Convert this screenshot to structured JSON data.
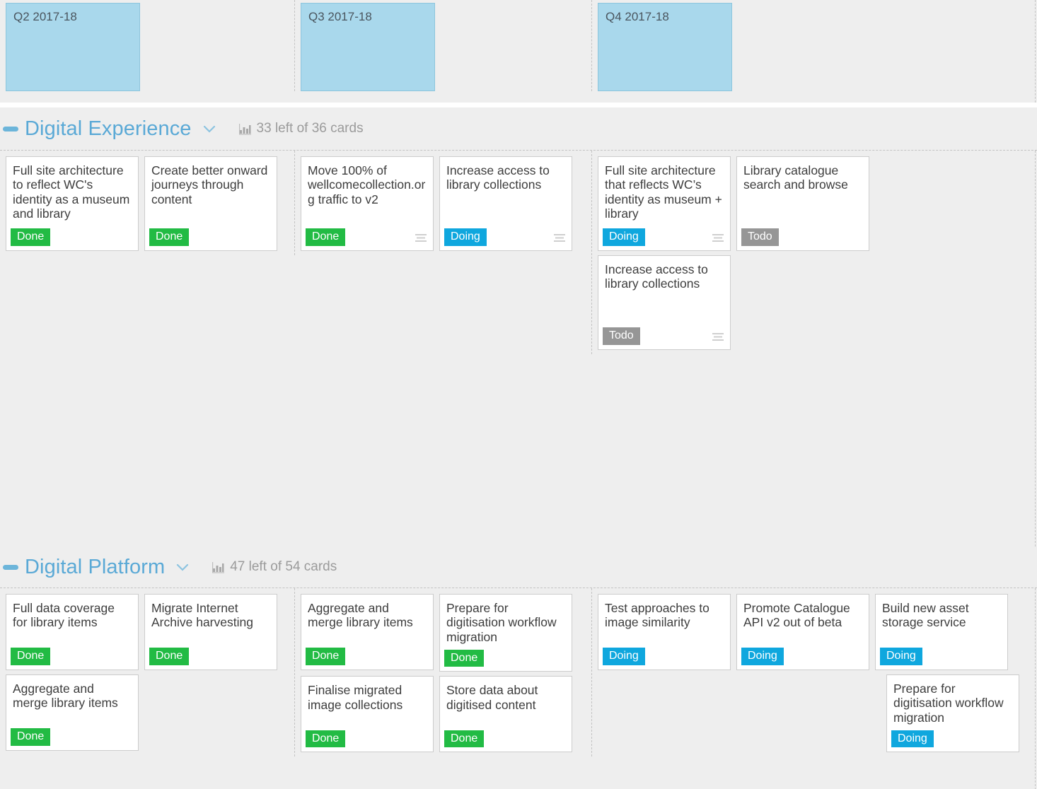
{
  "board": {
    "background_color": "#eeeeee",
    "card_background": "#ffffff",
    "accent_color": "#5aa9d6",
    "quarter_card_color": "#a9d8ec",
    "status_colors": {
      "Done": "#22bb44",
      "Doing": "#0fa7de",
      "Todo": "#969696"
    }
  },
  "timeline": {
    "quarters": [
      {
        "label": "Q2 2017-18"
      },
      {
        "label": "Q3 2017-18"
      },
      {
        "label": "Q4 2017-18"
      }
    ]
  },
  "swimlanes": [
    {
      "id": "digital-experience",
      "title": "Digital Experience",
      "count_text": "33 left of 36 cards",
      "collapse_icon": "minus-icon",
      "chevron_icon": "chevron-down-icon",
      "chart_icon": "bar-chart-icon",
      "columns": [
        {
          "quarter": "Q2 2017-18",
          "cards": [
            {
              "title": "Full site architecture to reflect WC's identity as a museum and library",
              "status": "Done",
              "has_description": false
            },
            {
              "title": "Create better onward journeys through content",
              "status": "Done",
              "has_description": false
            }
          ]
        },
        {
          "quarter": "Q3 2017-18",
          "cards": [
            {
              "title": "Move 100% of wellcomecollection.org traffic to v2",
              "status": "Done",
              "has_description": true
            },
            {
              "title": "Increase access to library collections",
              "status": "Doing",
              "has_description": true
            }
          ]
        },
        {
          "quarter": "Q4 2017-18",
          "cards": [
            {
              "title": "Full site architecture that reflects WC’s identity as museum + library",
              "status": "Doing",
              "has_description": true
            },
            {
              "title": "Library catalogue search and browse",
              "status": "Todo",
              "has_description": false
            },
            {
              "title": "Increase access to library collections",
              "status": "Todo",
              "has_description": true
            }
          ]
        }
      ]
    },
    {
      "id": "digital-platform",
      "title": "Digital Platform",
      "count_text": "47 left of 54 cards",
      "collapse_icon": "minus-icon",
      "chevron_icon": "chevron-down-icon",
      "chart_icon": "bar-chart-icon",
      "columns": [
        {
          "quarter": "Q2 2017-18",
          "cards": [
            {
              "title": "Full data coverage for library items",
              "status": "Done",
              "has_description": false
            },
            {
              "title": "Migrate Internet Archive harvesting",
              "status": "Done",
              "has_description": false
            },
            {
              "title": "Aggregate and merge library items",
              "status": "Done",
              "has_description": false
            }
          ]
        },
        {
          "quarter": "Q3 2017-18",
          "cards": [
            {
              "title": "Aggregate and merge library items",
              "status": "Done",
              "has_description": false
            },
            {
              "title": "Prepare for digitisation workflow migration",
              "status": "Done",
              "has_description": false
            },
            {
              "title": "Finalise migrated image collections",
              "status": "Done",
              "has_description": false
            },
            {
              "title": "Store data about digitised content",
              "status": "Done",
              "has_description": false
            }
          ]
        },
        {
          "quarter": "Q4 2017-18",
          "cards": [
            {
              "title": "Test approaches to image similarity",
              "status": "Doing",
              "has_description": false
            },
            {
              "title": "Promote Catalogue API v2 out of beta",
              "status": "Doing",
              "has_description": false
            },
            {
              "title": "Build new asset storage service",
              "status": "Doing",
              "has_description": false
            },
            {
              "title": "Prepare for digitisation workflow migration",
              "status": "Doing",
              "has_description": false
            }
          ]
        }
      ]
    }
  ]
}
